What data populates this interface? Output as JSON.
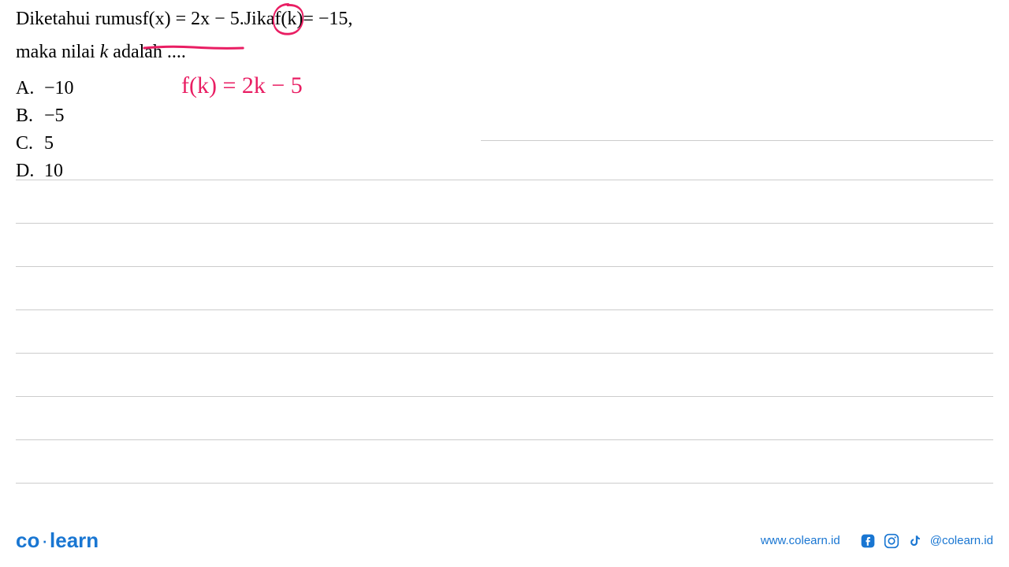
{
  "question": {
    "prefix": "Diketahui rumus ",
    "formula": "f(x) = 2x − 5.",
    "jika_prefix": "  Jika ",
    "fk": "f(k)",
    "equals_val": " = −15,",
    "line2_a": "maka nilai ",
    "line2_k": "k",
    "line2_b": " adalah ...."
  },
  "options": {
    "a_letter": "A.",
    "a_value": "−10",
    "b_letter": "B.",
    "b_value": "−5",
    "c_letter": "C.",
    "c_value": "5",
    "d_letter": "D.",
    "d_value": "10"
  },
  "handwriting": "f(k) = 2k − 5",
  "footer": {
    "logo_co": "co",
    "logo_dot": "·",
    "logo_learn": "learn",
    "url": "www.colearn.id",
    "handle": "@colearn.id"
  },
  "colors": {
    "annotation": "#e91e63",
    "brand": "#1976d2"
  }
}
